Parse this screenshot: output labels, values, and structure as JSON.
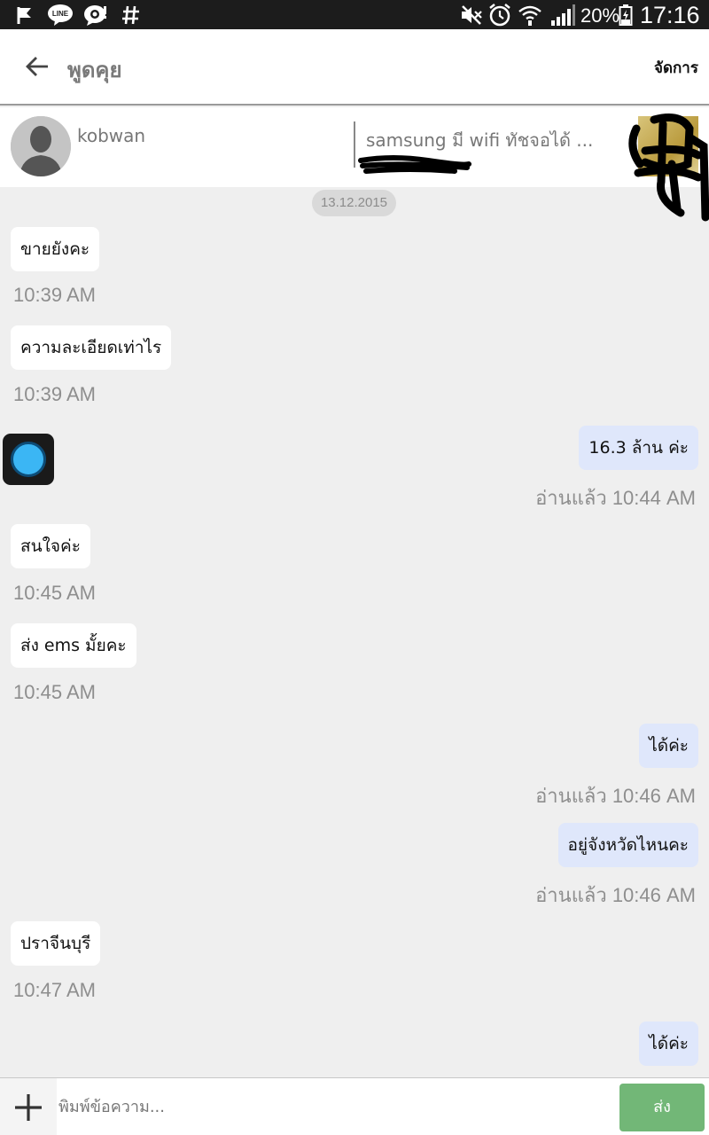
{
  "status_bar": {
    "icons": [
      "flag-icon",
      "line-app-icon",
      "chat-notify-icon",
      "hash-icon",
      "mute-icon",
      "alarm-icon",
      "wifi-icon",
      "signal-icon",
      "battery-icon"
    ],
    "battery": "20%",
    "clock": "17:16"
  },
  "app_bar": {
    "title": "พูดคุย",
    "manage_label": "จัดการ"
  },
  "product_header": {
    "seller_name": "kobwan",
    "product_title": "samsung มี wifi  ทัชจอได้ ..."
  },
  "chat": {
    "date": "13.12.2015",
    "messages": [
      {
        "side": "in",
        "text": "ขายยังคะ",
        "time": "10:39 AM"
      },
      {
        "side": "in",
        "text": "ความละเอียดเท่าไร",
        "time": "10:39 AM"
      },
      {
        "side": "out",
        "text": "16.3  ล้าน ค่ะ",
        "time": "อ่านแล้ว 10:44 AM"
      },
      {
        "side": "in",
        "text": "สนใจค่ะ",
        "time": "10:45 AM"
      },
      {
        "side": "in",
        "text": "ส่ง ems มั้ยคะ",
        "time": "10:45 AM"
      },
      {
        "side": "out",
        "text": "ได้ค่ะ",
        "time": "อ่านแล้ว 10:46 AM"
      },
      {
        "side": "out",
        "text": "อยู่จังหวัดไหนคะ",
        "time": "อ่านแล้ว 10:46 AM"
      },
      {
        "side": "in",
        "text": "ปราจีนบุรี",
        "time": "10:47 AM"
      },
      {
        "side": "out",
        "text": "ได้ค่ะ",
        "time": ""
      }
    ]
  },
  "input_bar": {
    "placeholder": "พิมพ์ข้อความ...",
    "send_label": "ส่ง"
  },
  "colors": {
    "status_bar_bg": "#1c1c1c",
    "incoming_bubble": "#ffffff",
    "outgoing_bubble": "#dfe7fb",
    "chat_bg": "#efefef",
    "send_button": "#72b777",
    "sticker_blue": "#3bb6f4"
  }
}
